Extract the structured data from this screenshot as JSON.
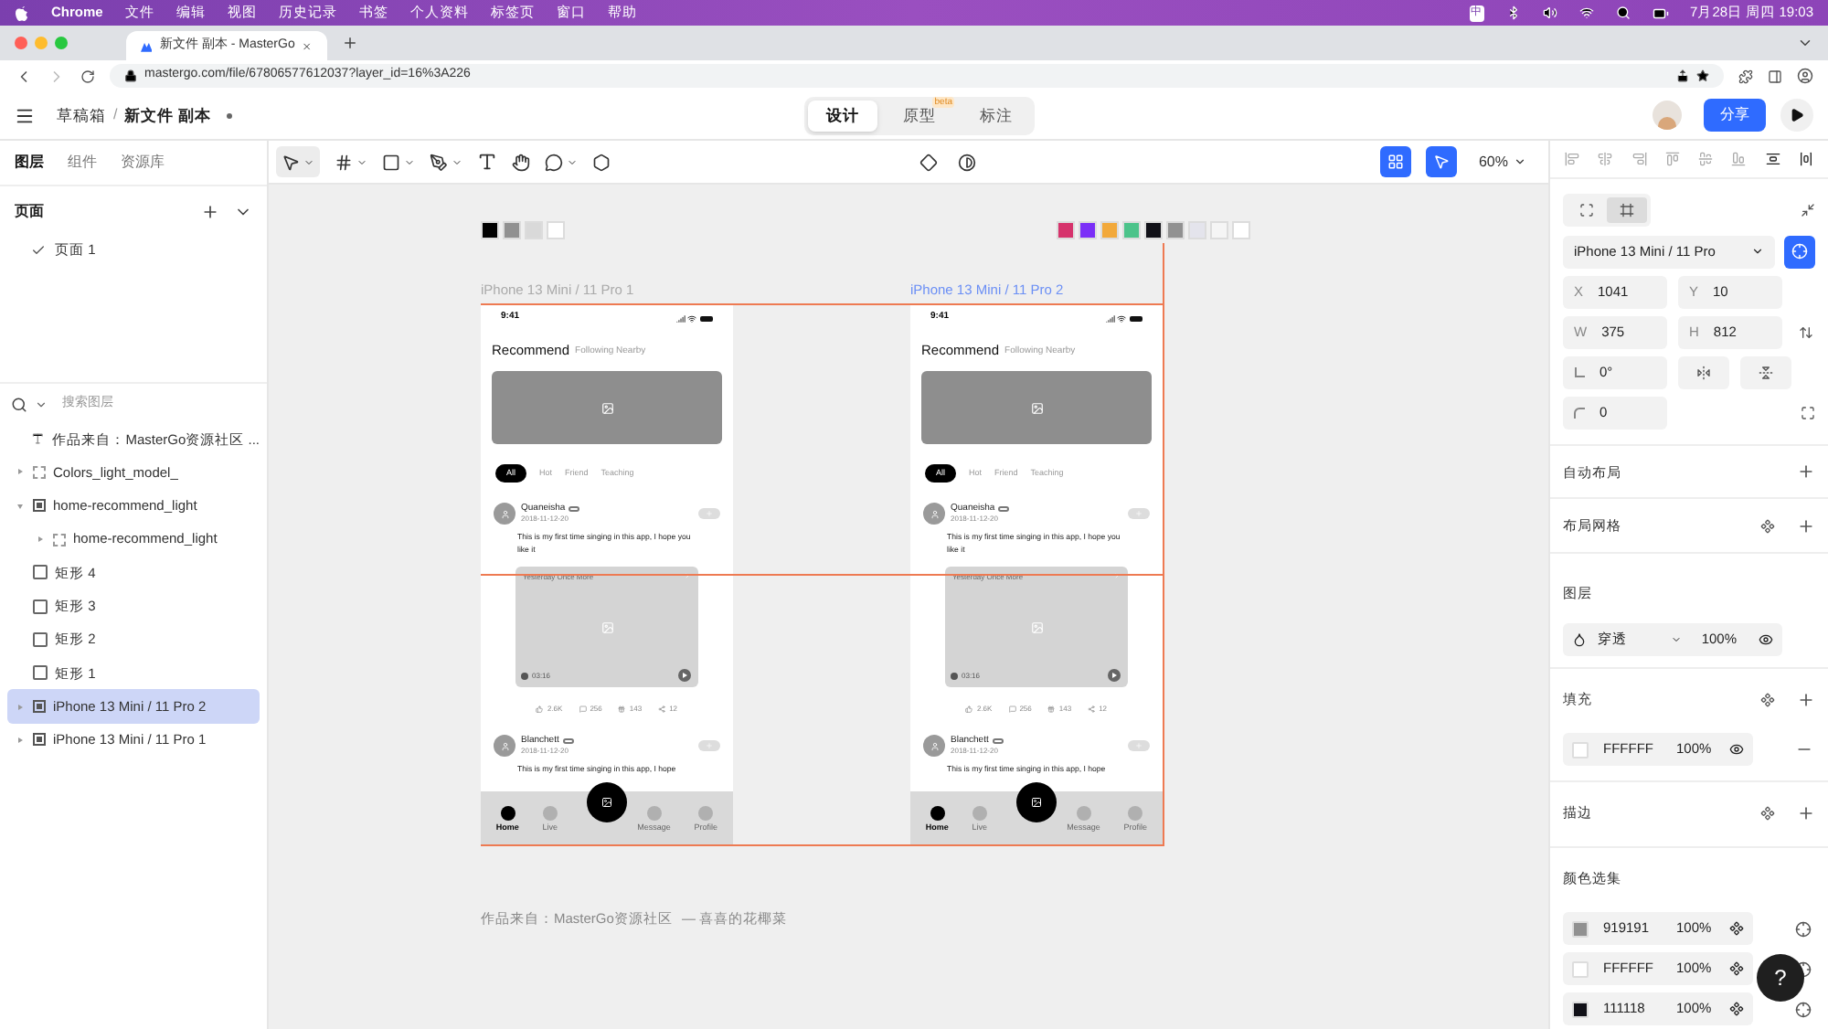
{
  "menu_bar": {
    "app": "Chrome",
    "items": [
      "文件",
      "编辑",
      "视图",
      "历史记录",
      "书签",
      "个人资料",
      "标签页",
      "窗口",
      "帮助"
    ],
    "input_method": "中",
    "clock": "7月28日 周四 19:03"
  },
  "browser": {
    "tab_title": "新文件 副本 - MasterGo",
    "url": "mastergo.com/file/67806577612037?layer_id=16%3A226"
  },
  "header": {
    "breadcrumb": "草稿箱",
    "separator": "/",
    "file_name": "新文件 副本",
    "modes": [
      {
        "label": "设计",
        "selected": true
      },
      {
        "label": "原型",
        "selected": false,
        "badge": "beta"
      },
      {
        "label": "标注",
        "selected": false
      }
    ],
    "share": "分享"
  },
  "left_panel": {
    "tabs": [
      {
        "label": "图层",
        "selected": true
      },
      {
        "label": "组件",
        "selected": false
      },
      {
        "label": "资源库",
        "selected": false
      }
    ],
    "pages_title": "页面",
    "pages": [
      {
        "label": "页面 1",
        "selected": true
      }
    ],
    "search_placeholder": "搜索图层",
    "layers": [
      {
        "kind": "text",
        "label": "作品来自：MasterGo资源社区 ...",
        "selected": false
      },
      {
        "kind": "group",
        "label": "Colors_light_model_",
        "expanded": false,
        "selected": false
      },
      {
        "kind": "frame",
        "label": "home-recommend_light",
        "expanded": true,
        "selected": false,
        "children": [
          {
            "kind": "group",
            "label": "home-recommend_light",
            "expanded": false,
            "selected": false
          }
        ]
      },
      {
        "kind": "rect",
        "label": "矩形 4",
        "selected": false
      },
      {
        "kind": "rect",
        "label": "矩形 3",
        "selected": false
      },
      {
        "kind": "rect",
        "label": "矩形 2",
        "selected": false
      },
      {
        "kind": "rect",
        "label": "矩形 1",
        "selected": false
      },
      {
        "kind": "frame",
        "label": "iPhone 13 Mini / 11 Pro 2",
        "expanded": false,
        "selected": true
      },
      {
        "kind": "frame",
        "label": "iPhone 13 Mini / 11 Pro 1",
        "expanded": false,
        "selected": false
      }
    ]
  },
  "toolbar": {
    "zoom": "60%"
  },
  "canvas": {
    "swatch_groups": [
      {
        "swatches": [
          {
            "color": "#000000"
          },
          {
            "color": "#919191"
          },
          {
            "color": "#d9d9d9"
          },
          {
            "color": "#ffffff"
          }
        ]
      },
      {
        "swatches": [
          {
            "color": "#d6336c"
          },
          {
            "color": "#7b2ff7"
          },
          {
            "color": "#f2a93b"
          },
          {
            "color": "#4cc38a"
          },
          {
            "color": "#111118"
          },
          {
            "color": "#919191"
          },
          {
            "color": "#e4e4ec"
          },
          {
            "color": "#f5f5f5"
          },
          {
            "color": "#ffffff"
          }
        ]
      }
    ],
    "frames": [
      {
        "label": "iPhone 13 Mini / 11 Pro 1",
        "selected": false,
        "time": "9:41",
        "title": "Recommend",
        "subtitle": "Following Nearby",
        "chips": [
          {
            "label": "All",
            "selected": true
          },
          {
            "label": "Hot",
            "selected": false
          },
          {
            "label": "Friend",
            "selected": false
          },
          {
            "label": "Teaching",
            "selected": false
          }
        ],
        "post": {
          "name": "Quaneisha",
          "date": "2018-11-12-20",
          "text": "This is my first time singing in this app, I hope you like it",
          "video_title": "Yesterday Once More",
          "duration": "03:16",
          "stats": [
            "2.6K",
            "256",
            "143",
            "12"
          ]
        },
        "post2": {
          "name": "Blanchett",
          "date": "2018-11-12-20",
          "text": "This is my first time singing in this app, I hope"
        },
        "nav": [
          {
            "label": "Home",
            "selected": true
          },
          {
            "label": "Live",
            "selected": false
          },
          {
            "label": "Message",
            "selected": false
          },
          {
            "label": "Profile",
            "selected": false
          }
        ]
      },
      {
        "label": "iPhone 13 Mini / 11 Pro 2",
        "selected": true,
        "time": "9:41",
        "title": "Recommend",
        "subtitle": "Following Nearby",
        "chips": [
          {
            "label": "All",
            "selected": true
          },
          {
            "label": "Hot",
            "selected": false
          },
          {
            "label": "Friend",
            "selected": false
          },
          {
            "label": "Teaching",
            "selected": false
          }
        ],
        "post": {
          "name": "Quaneisha",
          "date": "2018-11-12-20",
          "text": "This is my first time singing in this app, I hope you like it",
          "video_title": "Yesterday Once More",
          "duration": "03:16",
          "stats": [
            "2.6K",
            "256",
            "143",
            "12"
          ]
        },
        "post2": {
          "name": "Blanchett",
          "date": "2018-11-12-20",
          "text": "This is my first time singing in this app, I hope"
        },
        "nav": [
          {
            "label": "Home",
            "selected": true
          },
          {
            "label": "Live",
            "selected": false
          },
          {
            "label": "Message",
            "selected": false
          },
          {
            "label": "Profile",
            "selected": false
          }
        ]
      }
    ],
    "caption": "作品来自：MasterGo资源社区",
    "author": "— 喜喜的花椰菜"
  },
  "right_panel": {
    "layout_modes": [
      {
        "selected": false
      },
      {
        "selected": true
      }
    ],
    "preset": "iPhone 13 Mini / 11 Pro",
    "position": [
      {
        "label": "X",
        "value": "1041"
      },
      {
        "label": "Y",
        "value": "10"
      }
    ],
    "size": [
      {
        "label": "W",
        "value": "375"
      },
      {
        "label": "H",
        "value": "812"
      }
    ],
    "rotation": "0°",
    "radius": "0",
    "sections": {
      "auto_layout": "自动布局",
      "layout_grid": "布局网格",
      "layer": "图层",
      "fill": "填充",
      "stroke": "描边",
      "color_selection": "颜色选集"
    },
    "blend": "穿透",
    "opacity": "100%",
    "fills": [
      {
        "hex": "FFFFFF",
        "opacity": "100%",
        "color": "#ffffff"
      }
    ],
    "selection_colors": [
      {
        "hex": "919191",
        "opacity": "100%",
        "color": "#919191"
      },
      {
        "hex": "FFFFFF",
        "opacity": "100%",
        "color": "#ffffff"
      },
      {
        "hex": "111118",
        "opacity": "100%",
        "color": "#111118"
      }
    ],
    "help": "?"
  }
}
